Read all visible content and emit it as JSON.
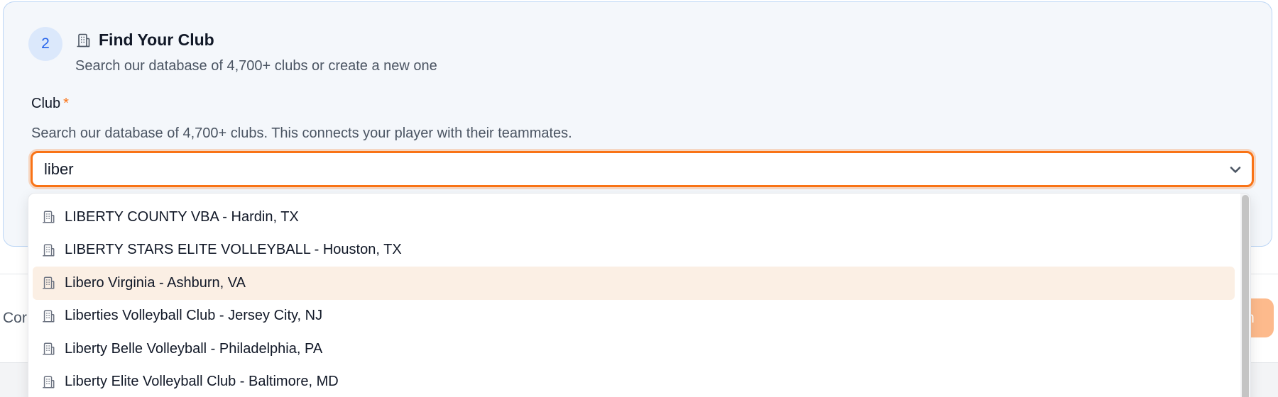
{
  "step": {
    "number": "2",
    "icon": "building-icon",
    "title": "Find Your Club",
    "subtitle": "Search our database of 4,700+ clubs or create a new one"
  },
  "club_field": {
    "label": "Club",
    "required_mark": "*",
    "help_text": "Search our database of 4,700+ clubs. This connects your player with their teammates.",
    "value": "liber",
    "dropdown_icon": "chevron-down-icon"
  },
  "dropdown": {
    "highlighted_index": 2,
    "items": [
      {
        "label": "LIBERTY COUNTY VBA - Hardin, TX",
        "icon": "building-icon"
      },
      {
        "label": "LIBERTY STARS ELITE VOLLEYBALL - Houston, TX",
        "icon": "building-icon"
      },
      {
        "label": "Libero Virginia - Ashburn, VA",
        "icon": "building-icon"
      },
      {
        "label": "Liberties Volleyball Club - Jersey City, NJ",
        "icon": "building-icon"
      },
      {
        "label": "Liberty Belle Volleyball - Philadelphia, PA",
        "icon": "building-icon"
      },
      {
        "label": "Liberty Elite Volleyball Club - Baltimore, MD",
        "icon": "building-icon"
      }
    ]
  },
  "footer": {
    "left_text": "Cor",
    "button_label": "n"
  },
  "colors": {
    "accent": "#f97316",
    "card_background": "#f4f7fb",
    "card_border": "#bcd6f5",
    "badge_background": "#dbe8fb",
    "badge_text": "#2563eb",
    "highlight_row": "#fbefe4"
  }
}
